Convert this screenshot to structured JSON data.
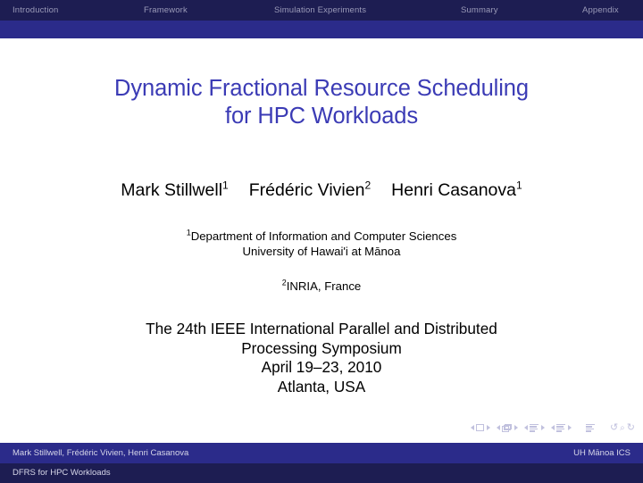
{
  "nav": {
    "items": [
      {
        "label": "Introduction"
      },
      {
        "label": "Framework"
      },
      {
        "label": "Simulation Experiments"
      },
      {
        "label": "Summary"
      },
      {
        "label": "Appendix"
      }
    ]
  },
  "title": {
    "line1": "Dynamic Fractional Resource Scheduling",
    "line2": "for HPC Workloads",
    "color": "#3b3bb5"
  },
  "authors": [
    {
      "name": "Mark Stillwell",
      "affiliation_marker": "1"
    },
    {
      "name": "Frédéric Vivien",
      "affiliation_marker": "2"
    },
    {
      "name": "Henri Casanova",
      "affiliation_marker": "1"
    }
  ],
  "affiliations": [
    {
      "marker": "1",
      "line1": "Department of Information and Computer Sciences",
      "line2": "University of Hawai'i at Mānoa"
    },
    {
      "marker": "2",
      "line1": "INRIA, France",
      "line2": ""
    }
  ],
  "conference": {
    "line1": "The 24th IEEE International Parallel and Distributed",
    "line2": "Processing Symposium",
    "line3": "April 19–23, 2010",
    "line4": "Atlanta, USA"
  },
  "nav_symbols": {
    "slide_icon": "slide-icon",
    "frame_icon": "frame-stack-icon",
    "subsection_icon": "subsection-icon",
    "section_icon": "section-icon",
    "doc_icon": "document-icon",
    "back_icon": "go-back-icon",
    "search_icon": "search-icon",
    "forward_icon": "go-forward-icon",
    "back_glyph": "↺",
    "search_glyph": "⌕",
    "forward_glyph": "↻"
  },
  "footer": {
    "authors": "Mark Stillwell, Frédéric Vivien, Henri Casanova",
    "institution": "UH Mānoa ICS",
    "short_title": "DFRS for HPC Workloads",
    "bar_color": "#2b2b8a",
    "dark_color": "#1d1d52"
  }
}
